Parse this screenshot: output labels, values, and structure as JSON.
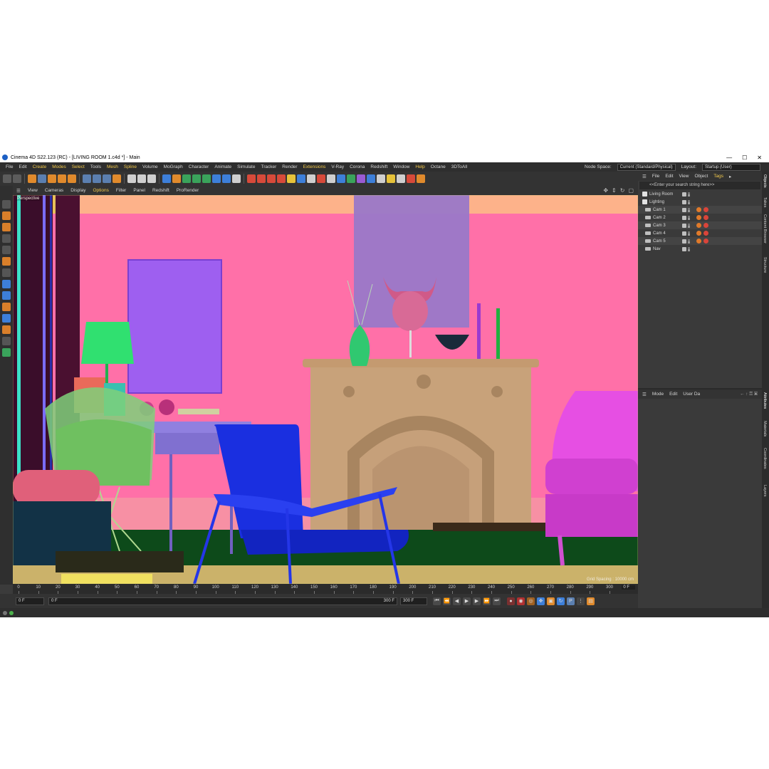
{
  "window": {
    "title": "Cinema 4D S22.123 (RC) - [LIVING ROOM 1.c4d *] - Main",
    "controls": [
      "—",
      "☐",
      "✕"
    ]
  },
  "menu": {
    "items": [
      "File",
      "Edit",
      "Create",
      "Modes",
      "Select",
      "Tools",
      "Mesh",
      "Spline",
      "Volume",
      "MoGraph",
      "Character",
      "Animate",
      "Simulate",
      "Tracker",
      "Render",
      "Extensions",
      "V-Ray",
      "Corona",
      "Redshift",
      "Window",
      "Help",
      "Octane",
      "3DToAll"
    ],
    "highlighted": [
      "Create",
      "Modes",
      "Select",
      "Mesh",
      "Spline",
      "Extensions",
      "Help"
    ],
    "node_space_label": "Node Space:",
    "node_space_value": "Current (Standard/Physical)",
    "layout_label": "Layout:",
    "layout_value": "Startup (User)"
  },
  "viewport_menu": {
    "items": [
      "View",
      "Cameras",
      "Display",
      "Options",
      "Filter",
      "Panel",
      "Redshift",
      "ProRender"
    ],
    "highlighted": "Options"
  },
  "viewport": {
    "label": "Perspective",
    "grid_spacing": "Grid Spacing : 10000 cm"
  },
  "timeline": {
    "ticks": [
      "0",
      "10",
      "20",
      "30",
      "40",
      "50",
      "60",
      "70",
      "80",
      "90",
      "100",
      "110",
      "120",
      "130",
      "140",
      "150",
      "160",
      "170",
      "180",
      "190",
      "200",
      "210",
      "220",
      "230",
      "240",
      "250",
      "260",
      "270",
      "280",
      "290",
      "300"
    ],
    "current_frame": "0 F"
  },
  "transport": {
    "start_field": "0 F",
    "min_field": "0 F",
    "max_field": "300 F",
    "end_field": "300 F"
  },
  "objects_panel": {
    "menu": [
      "File",
      "Edit",
      "View",
      "Object",
      "Tags",
      "▸"
    ],
    "search_placeholder": "<<Enter your search string here>>",
    "objects": [
      {
        "name": "Living Room",
        "kind": "null",
        "tags": 0
      },
      {
        "name": "Lighting",
        "kind": "null",
        "tags": 0
      },
      {
        "name": "Cam 1",
        "kind": "camera",
        "tags": 2
      },
      {
        "name": "Cam 2",
        "kind": "camera",
        "tags": 2
      },
      {
        "name": "Cam 3",
        "kind": "camera",
        "tags": 2
      },
      {
        "name": "Cam 4",
        "kind": "camera",
        "tags": 2
      },
      {
        "name": "Cam 5",
        "kind": "camera",
        "tags": 2
      },
      {
        "name": "Nav",
        "kind": "camera",
        "tags": 0
      }
    ]
  },
  "attributes_panel": {
    "menu": [
      "Mode",
      "Edit",
      "User Da"
    ]
  },
  "side_tabs": [
    "Objects",
    "Takes",
    "Content Browser",
    "Structure",
    "Attributes",
    "Materials",
    "Coordinates",
    "Layers"
  ],
  "colors": {
    "wall": "#ff70a8",
    "ceiling_band": "#fdb28a",
    "fireplace": "#c8a27a",
    "chair_blue": "#1a2fe0",
    "armchair_magenta": "#e64fe3",
    "accent_ui": "#f2c94c"
  }
}
